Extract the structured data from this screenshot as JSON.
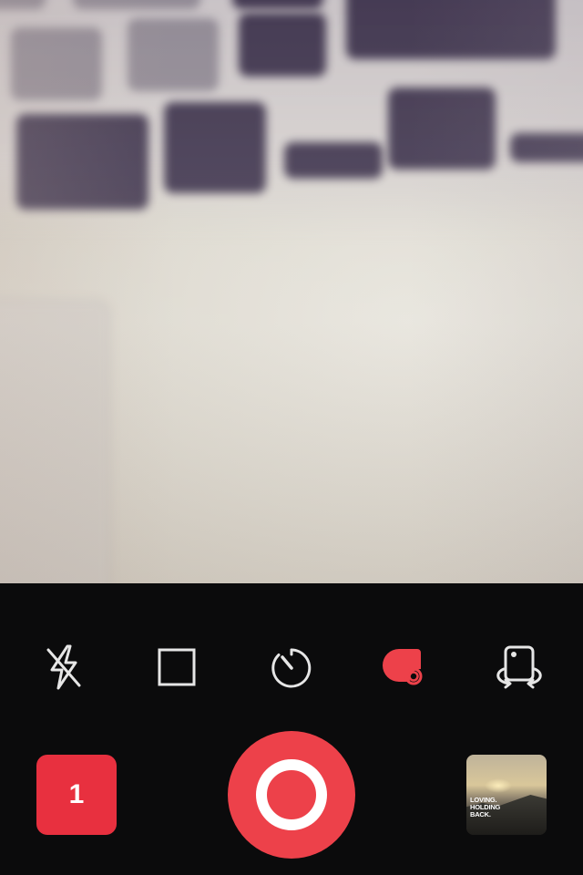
{
  "colors": {
    "accent_red": "#ed414a",
    "badge_red": "#e8303f",
    "panel_bg": "#0b0b0c",
    "icon_light": "#e6e6e6"
  },
  "viewfinder": {
    "scene": "blurred-laptop-keyboard-and-desk"
  },
  "toolbar": {
    "items": [
      {
        "icon": "flash-off-icon"
      },
      {
        "icon": "square-crop-icon"
      },
      {
        "icon": "timer-icon"
      },
      {
        "icon": "camera-mode-icon",
        "active": true
      },
      {
        "icon": "switch-camera-icon"
      }
    ]
  },
  "capture": {
    "count_label": "1",
    "shutter_icon": "shutter-ring-icon"
  },
  "last_photo": {
    "caption": "LOVING. HOLDING BACK."
  }
}
